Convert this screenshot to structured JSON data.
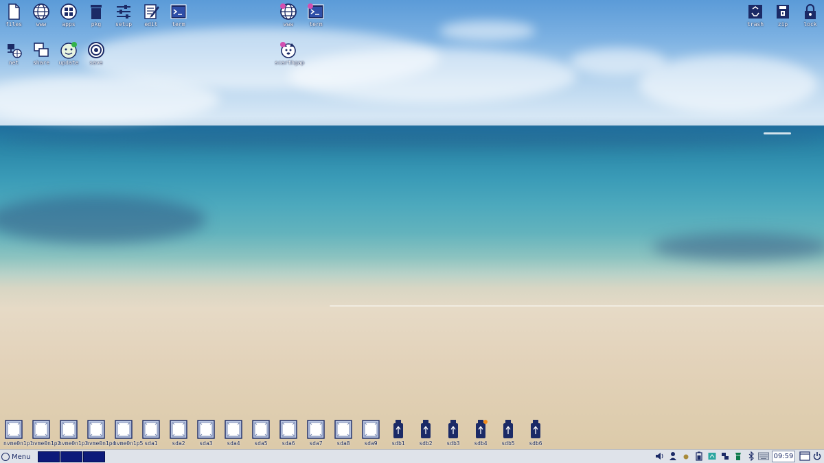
{
  "desktop": {
    "left_icons_row1": [
      {
        "label": "files",
        "icon": "file-icon"
      },
      {
        "label": "www",
        "icon": "globe-icon"
      },
      {
        "label": "apps",
        "icon": "apps-grid-icon"
      },
      {
        "label": "pkg",
        "icon": "package-icon"
      },
      {
        "label": "setup",
        "icon": "sliders-icon"
      },
      {
        "label": "edit",
        "icon": "edit-icon"
      },
      {
        "label": "term",
        "icon": "terminal-icon"
      }
    ],
    "left_icons_row2": [
      {
        "label": "net",
        "icon": "network-icon"
      },
      {
        "label": "share",
        "icon": "share-icon"
      },
      {
        "label": "update",
        "icon": "update-icon"
      },
      {
        "label": "save",
        "icon": "save-target-icon"
      }
    ],
    "center_icons": [
      {
        "label": "www",
        "icon": "globe-icon"
      },
      {
        "label": "term",
        "icon": "terminal-icon"
      },
      {
        "label": "scarthgap",
        "icon": "puppy-icon"
      }
    ],
    "right_icons": [
      {
        "label": "trash",
        "icon": "trash-icon"
      },
      {
        "label": "zip",
        "icon": "zip-icon"
      },
      {
        "label": "lock",
        "icon": "lock-icon"
      }
    ],
    "drives": [
      {
        "label": "nvme0n1p1",
        "type": "partition"
      },
      {
        "label": "nvme0n1p2",
        "type": "partition"
      },
      {
        "label": "nvme0n1p3",
        "type": "partition"
      },
      {
        "label": "nvme0n1p4",
        "type": "partition"
      },
      {
        "label": "nvme0n1p5",
        "type": "partition"
      },
      {
        "label": "sda1",
        "type": "partition"
      },
      {
        "label": "sda2",
        "type": "partition"
      },
      {
        "label": "sda3",
        "type": "partition"
      },
      {
        "label": "sda4",
        "type": "partition"
      },
      {
        "label": "sda5",
        "type": "partition"
      },
      {
        "label": "sda6",
        "type": "partition"
      },
      {
        "label": "sda7",
        "type": "partition"
      },
      {
        "label": "sda8",
        "type": "partition"
      },
      {
        "label": "sda9",
        "type": "partition"
      },
      {
        "label": "sdb1",
        "type": "usb"
      },
      {
        "label": "sdb2",
        "type": "usb"
      },
      {
        "label": "sdb3",
        "type": "usb"
      },
      {
        "label": "sdb4",
        "type": "usb"
      },
      {
        "label": "sdb5",
        "type": "usb"
      },
      {
        "label": "sdb6",
        "type": "usb"
      }
    ]
  },
  "taskbar": {
    "menu_label": "Menu",
    "workspaces": 3,
    "tray_icons": [
      "volume-icon",
      "user-icon",
      "power-icon",
      "battery-icon",
      "display-icon",
      "network-tray-icon",
      "updates-tray-icon",
      "bluetooth-icon",
      "keyboard-icon"
    ],
    "clock": "09:59"
  },
  "colors": {
    "icon_navy": "#1b2a66",
    "taskbar_bg": "#dfe3ea",
    "workspace_active": "#0c1a7a"
  }
}
